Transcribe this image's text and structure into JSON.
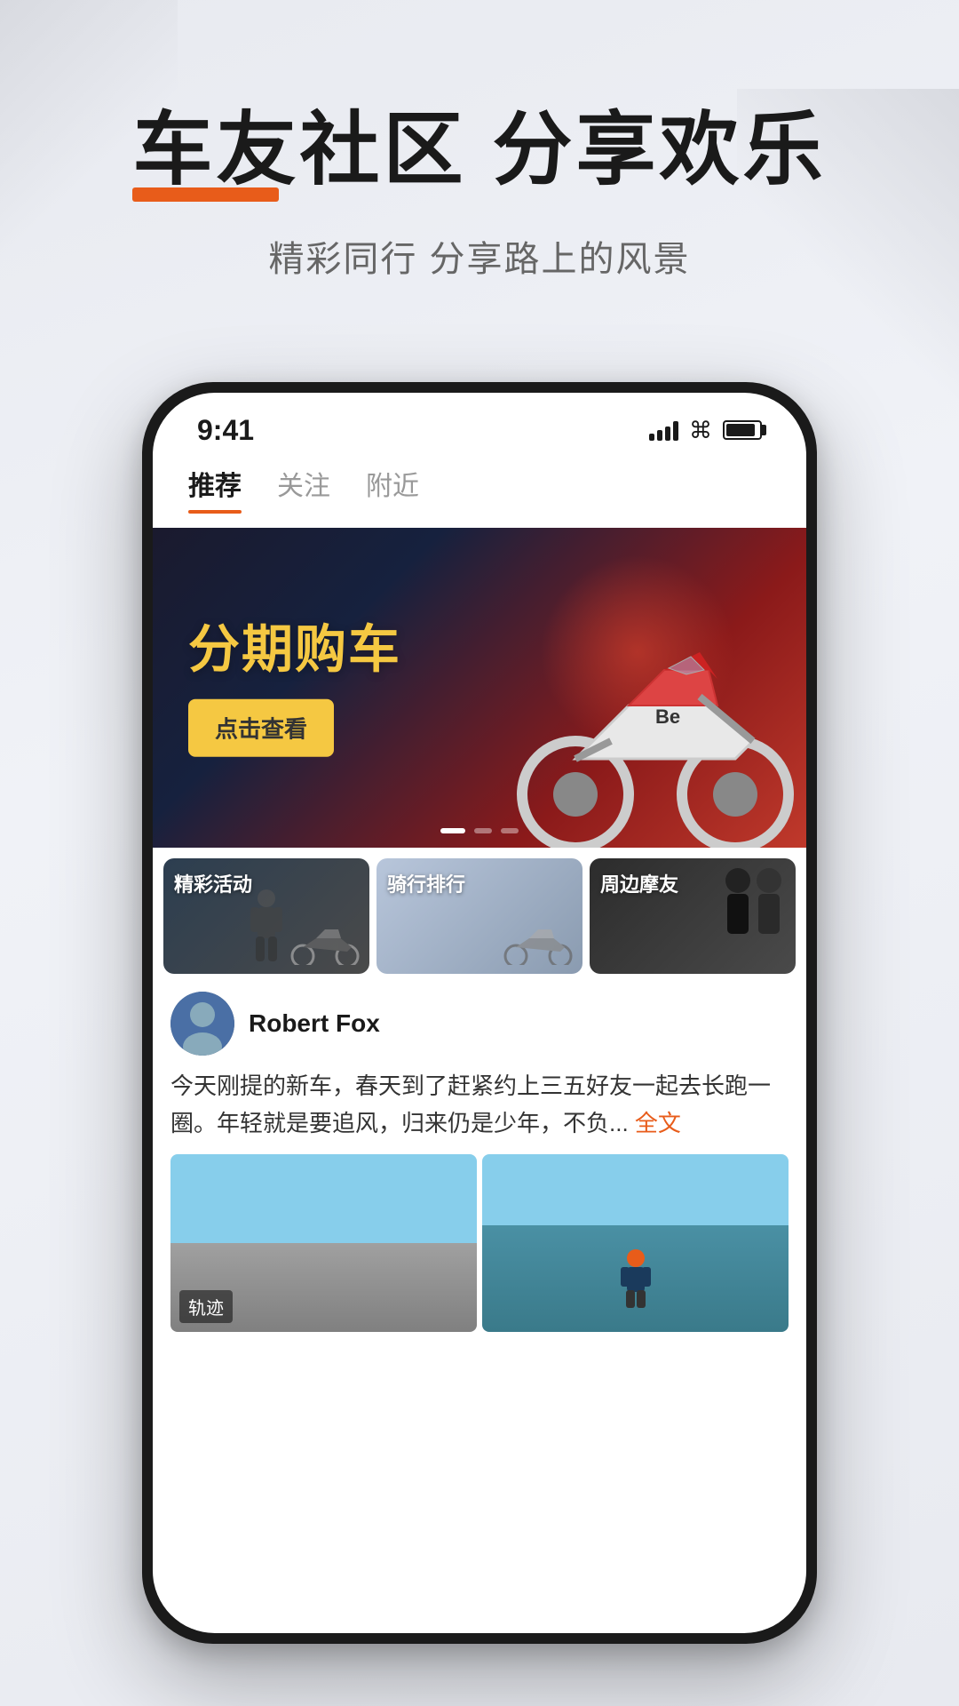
{
  "page": {
    "background_color": "#e8eaf0"
  },
  "header": {
    "main_title": "车友社区 分享欢乐",
    "subtitle": "精彩同行 分享路上的风景"
  },
  "status_bar": {
    "time": "9:41",
    "signal": "signal",
    "wifi": "wifi",
    "battery": "battery"
  },
  "nav_tabs": [
    {
      "label": "推荐",
      "active": true
    },
    {
      "label": "关注",
      "active": false
    },
    {
      "label": "附近",
      "active": false
    }
  ],
  "banner": {
    "title": "分期购车",
    "button_label": "点击查看",
    "dots": [
      true,
      false,
      false
    ]
  },
  "categories": [
    {
      "label": "精彩活动",
      "bg": "dark"
    },
    {
      "label": "骑行排行",
      "bg": "gray"
    },
    {
      "label": "周边摩友",
      "bg": "dark2"
    }
  ],
  "post": {
    "user_name": "Robert Fox",
    "content": "今天刚提的新车，春天到了赶紧约上三五好友一起去长跑一圈。年轻就是要追风，归来仍是少年，不负...",
    "more_text": "全文",
    "images": [
      {
        "label": "轨迹",
        "type": "road"
      },
      {
        "label": "",
        "type": "rider"
      }
    ]
  }
}
